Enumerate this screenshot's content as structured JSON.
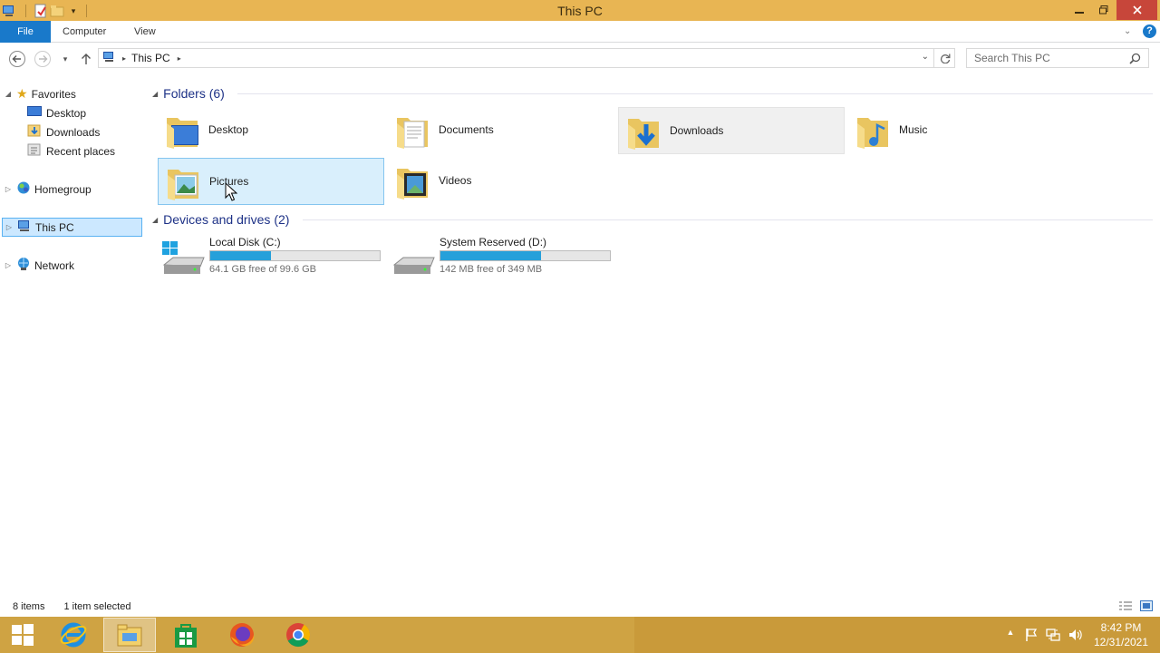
{
  "window": {
    "title": "This PC"
  },
  "ribbon": {
    "tabs": [
      "File",
      "Computer",
      "View"
    ]
  },
  "address": {
    "crumb": "This PC"
  },
  "search": {
    "placeholder": "Search This PC"
  },
  "nav": {
    "favorites": "Favorites",
    "favorites_items": [
      "Desktop",
      "Downloads",
      "Recent places"
    ],
    "homegroup": "Homegroup",
    "this_pc": "This PC",
    "network": "Network"
  },
  "folders": {
    "header": "Folders (6)",
    "items": [
      {
        "label": "Desktop",
        "icon": "desktop-folder-icon"
      },
      {
        "label": "Documents",
        "icon": "documents-folder-icon"
      },
      {
        "label": "Downloads",
        "icon": "downloads-folder-icon"
      },
      {
        "label": "Music",
        "icon": "music-folder-icon"
      },
      {
        "label": "Pictures",
        "icon": "pictures-folder-icon"
      },
      {
        "label": "Videos",
        "icon": "videos-folder-icon"
      }
    ]
  },
  "devices": {
    "header": "Devices and drives (2)",
    "items": [
      {
        "name": "Local Disk (C:)",
        "free_text": "64.1 GB free of 99.6 GB",
        "used_fraction": 0.356
      },
      {
        "name": "System Reserved (D:)",
        "free_text": "142 MB free of 349 MB",
        "used_fraction": 0.593
      }
    ]
  },
  "status": {
    "count": "8 items",
    "selection": "1 item selected"
  },
  "taskbar": {
    "time": "8:42 PM",
    "date": "12/31/2021"
  },
  "colors": {
    "titlebar": "#e8b553",
    "taskbar": "#cfa343",
    "accent": "#1979ca",
    "drive_fill": "#26a0da"
  }
}
